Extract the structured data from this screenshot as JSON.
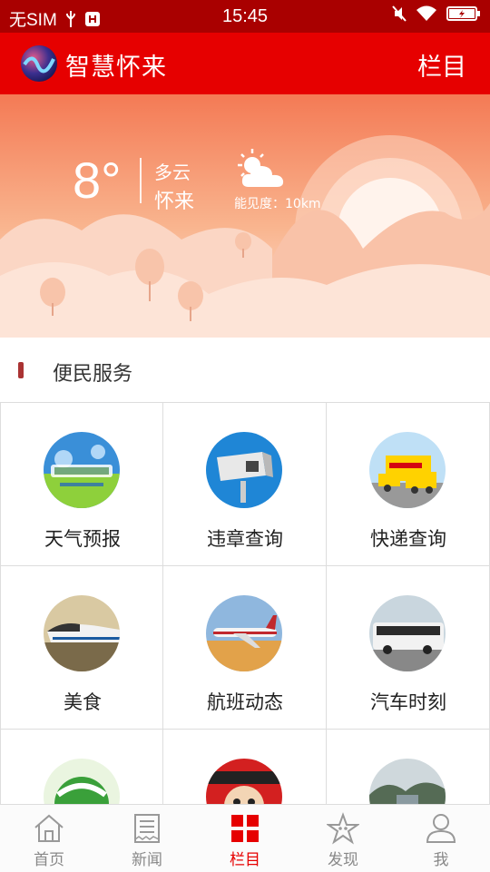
{
  "status_bar": {
    "carrier": "无SIM",
    "time": "15:45"
  },
  "header": {
    "app_title": "智慧怀来",
    "columns_label": "栏目"
  },
  "weather": {
    "temperature": "8°",
    "condition": "多云",
    "city": "怀来",
    "visibility": "能见度：10km",
    "icon": "partly-cloudy-icon"
  },
  "section": {
    "title": "便民服务"
  },
  "services": [
    {
      "label": "天气预报",
      "icon": "weather-forecast-image"
    },
    {
      "label": "违章查询",
      "icon": "traffic-camera-image"
    },
    {
      "label": "快递查询",
      "icon": "delivery-truck-image"
    },
    {
      "label": "美食",
      "icon": "bullet-train-image"
    },
    {
      "label": "航班动态",
      "icon": "airplane-image"
    },
    {
      "label": "汽车时刻",
      "icon": "bus-image"
    },
    {
      "label": "",
      "icon": "health-globe-image"
    },
    {
      "label": "",
      "icon": "cartoon-image"
    },
    {
      "label": "",
      "icon": "scenery-image"
    }
  ],
  "tabs": [
    {
      "label": "首页",
      "icon": "home-icon",
      "active": false
    },
    {
      "label": "新闻",
      "icon": "news-icon",
      "active": false
    },
    {
      "label": "栏目",
      "icon": "grid-icon",
      "active": true
    },
    {
      "label": "发现",
      "icon": "star-icon",
      "active": false
    },
    {
      "label": "我",
      "icon": "user-icon",
      "active": false
    }
  ],
  "colors": {
    "header_red": "#e60000",
    "status_red": "#a90000",
    "banner_orange": "#f47a55",
    "tab_active": "#e60000"
  }
}
